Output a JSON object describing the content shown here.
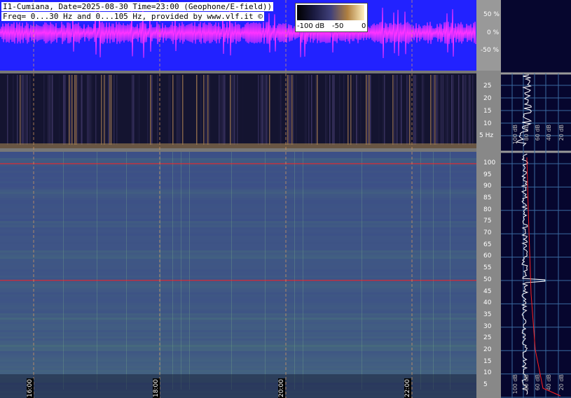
{
  "header": {
    "line1": "I1-Cumiana, Date=2025-08-30 Time=23:00 (Geophone/E-field))",
    "line2": "Freq= 0...30 Hz and 0...105 Hz, provided by www.vlf.it ©"
  },
  "colorbar": {
    "labels": [
      "-100 dB",
      "-50",
      "0"
    ]
  },
  "colors": {
    "waveform_bg": "#2222ff",
    "waveform": "#ff33ff",
    "low_bg": "#141430",
    "high_bg": "#3a4a8a",
    "marker": "#ff2020",
    "profile": "#ffffff"
  },
  "chart_data": [
    {
      "type": "line",
      "panel": "waveform",
      "ylabel_ticks": [
        "50 %",
        "0 %",
        "-50 %"
      ],
      "ylim": [
        -100,
        100
      ]
    },
    {
      "type": "heatmap",
      "panel": "spectrogram-low",
      "y_ticks": [
        "25",
        "20",
        "15",
        "10",
        "5 Hz"
      ],
      "ylim": [
        0,
        30
      ],
      "profile_ticks": [
        "100 dB",
        "80 dB",
        "60 dB",
        "40 dB",
        "20 dB"
      ]
    },
    {
      "type": "heatmap",
      "panel": "spectrogram-high",
      "y_ticks": [
        "100",
        "95",
        "90",
        "85",
        "80",
        "75",
        "70",
        "65",
        "60",
        "55",
        "50",
        "45",
        "40",
        "35",
        "30",
        "25",
        "20",
        "15",
        "10",
        "5"
      ],
      "ylim": [
        0,
        105
      ],
      "x_ticks": [
        "16:00",
        "18:00",
        "20:00",
        "22:00"
      ],
      "marker_lines_hz": [
        100,
        50
      ],
      "profile_ticks": [
        "100 dB",
        "80 dB",
        "60 dB",
        "40 dB",
        "20 dB"
      ]
    }
  ]
}
